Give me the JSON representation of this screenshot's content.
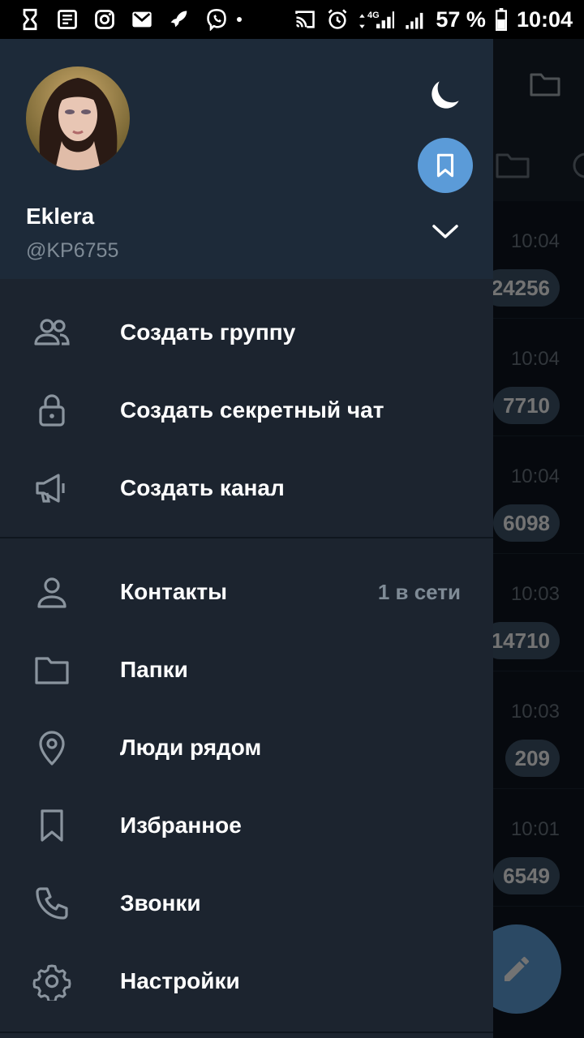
{
  "status_bar": {
    "battery": "57 %",
    "time": "10:04",
    "network": "4G"
  },
  "profile": {
    "name": "Eklera",
    "username": "@KP6755"
  },
  "menu_group_1": [
    {
      "label": "Создать группу",
      "icon": "group-icon"
    },
    {
      "label": "Создать секретный чат",
      "icon": "lock-icon"
    },
    {
      "label": "Создать канал",
      "icon": "megaphone-icon"
    }
  ],
  "menu_group_2": [
    {
      "label": "Контакты",
      "icon": "contact-icon",
      "value": "1 в сети"
    },
    {
      "label": "Папки",
      "icon": "folder-icon"
    },
    {
      "label": "Люди рядом",
      "icon": "location-pin-icon"
    },
    {
      "label": "Избранное",
      "icon": "bookmark-icon"
    },
    {
      "label": "Звонки",
      "icon": "phone-icon"
    },
    {
      "label": "Настройки",
      "icon": "gear-icon"
    }
  ],
  "background_chats": [
    {
      "time": "10:04",
      "badge": "24256"
    },
    {
      "time": "10:04",
      "badge": "7710"
    },
    {
      "time": "10:04",
      "badge": "6098"
    },
    {
      "time": "10:03",
      "badge": "14710"
    },
    {
      "time": "10:03",
      "badge": "209"
    },
    {
      "time": "10:01",
      "badge": "6549"
    }
  ],
  "colors": {
    "drawer_bg": "#1c242f",
    "header_bg": "#1d2a39",
    "accent": "#5b9bd8",
    "secondary_text": "#7f8b96"
  }
}
